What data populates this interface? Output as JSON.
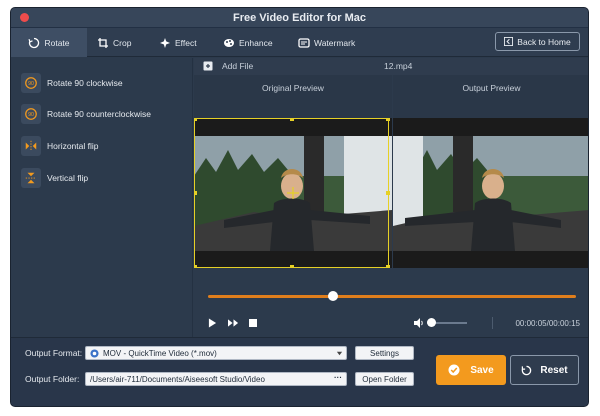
{
  "window": {
    "title": "Free Video Editor for Mac"
  },
  "toolbar": {
    "tabs": [
      {
        "label": "Rotate",
        "icon": "rotate-icon",
        "active": true
      },
      {
        "label": "Crop",
        "icon": "crop-icon",
        "active": false
      },
      {
        "label": "Effect",
        "icon": "effect-icon",
        "active": false
      },
      {
        "label": "Enhance",
        "icon": "enhance-icon",
        "active": false
      },
      {
        "label": "Watermark",
        "icon": "watermark-icon",
        "active": false
      }
    ],
    "back_label": "Back to Home"
  },
  "sidebar": {
    "items": [
      {
        "label": "Rotate 90 clockwise",
        "icon": "rotate-cw-icon"
      },
      {
        "label": "Rotate 90 counterclockwise",
        "icon": "rotate-ccw-icon"
      },
      {
        "label": "Horizontal flip",
        "icon": "horizontal-flip-icon"
      },
      {
        "label": "Vertical flip",
        "icon": "vertical-flip-icon"
      }
    ]
  },
  "file": {
    "add_label": "Add File",
    "name": "12.mp4"
  },
  "preview": {
    "original_label": "Original Preview",
    "output_label": "Output Preview"
  },
  "player": {
    "time": "00:00:05/00:00:15",
    "progress": 0.34,
    "volume": 0.0
  },
  "output": {
    "format_label": "Output Format:",
    "format_value": "MOV - QuickTime Video (*.mov)",
    "settings_label": "Settings",
    "folder_label": "Output Folder:",
    "folder_value": "/Users/air-711/Documents/Aiseesoft Studio/Video",
    "open_folder_label": "Open Folder"
  },
  "actions": {
    "save_label": "Save",
    "reset_label": "Reset"
  },
  "colors": {
    "accent": "#f39a1e",
    "crop": "#e6d026",
    "background": "#2c3a4c"
  }
}
